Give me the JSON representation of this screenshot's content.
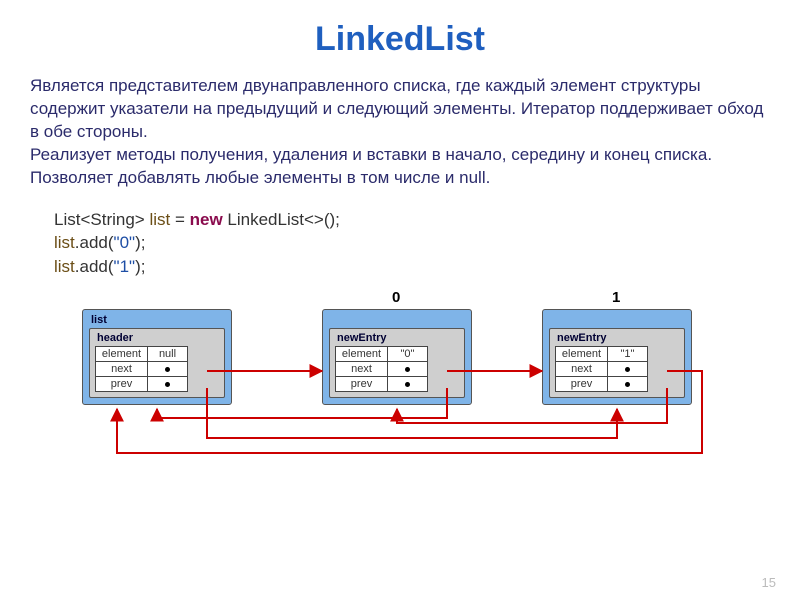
{
  "title": "LinkedList",
  "description": "Является представителем двунаправленного списка, где каждый элемент структуры содержит указатели на предыдущий и следующий элементы. Итератор поддерживает обход в обе стороны.\nРеализует методы получения, удаления и вставки в начало, середину и конец списка.\nПозволяет добавлять любые элементы в том числе и null.",
  "code": {
    "line1": {
      "type": "List<String>",
      "ident": "list",
      "eq": " = ",
      "new": "new",
      "ctor": " LinkedList<>();"
    },
    "line2": {
      "ident": "list",
      "call": ".add(",
      "str": "\"0\"",
      "end": ");"
    },
    "line3": {
      "ident": "list",
      "call": ".add(",
      "str": "\"1\"",
      "end": ");"
    }
  },
  "diagram": {
    "indices": [
      "0",
      "1"
    ],
    "list_label": "list",
    "header_label": "header",
    "newentry_label": "newEntry",
    "fields": {
      "element": "element",
      "next": "next",
      "prev": "prev"
    },
    "header_vals": {
      "element": "null",
      "next": "",
      "prev": ""
    },
    "node0_vals": {
      "element": "\"0\"",
      "next": "",
      "prev": ""
    },
    "node1_vals": {
      "element": "\"1\"",
      "next": "",
      "prev": ""
    }
  },
  "page_number": "15"
}
